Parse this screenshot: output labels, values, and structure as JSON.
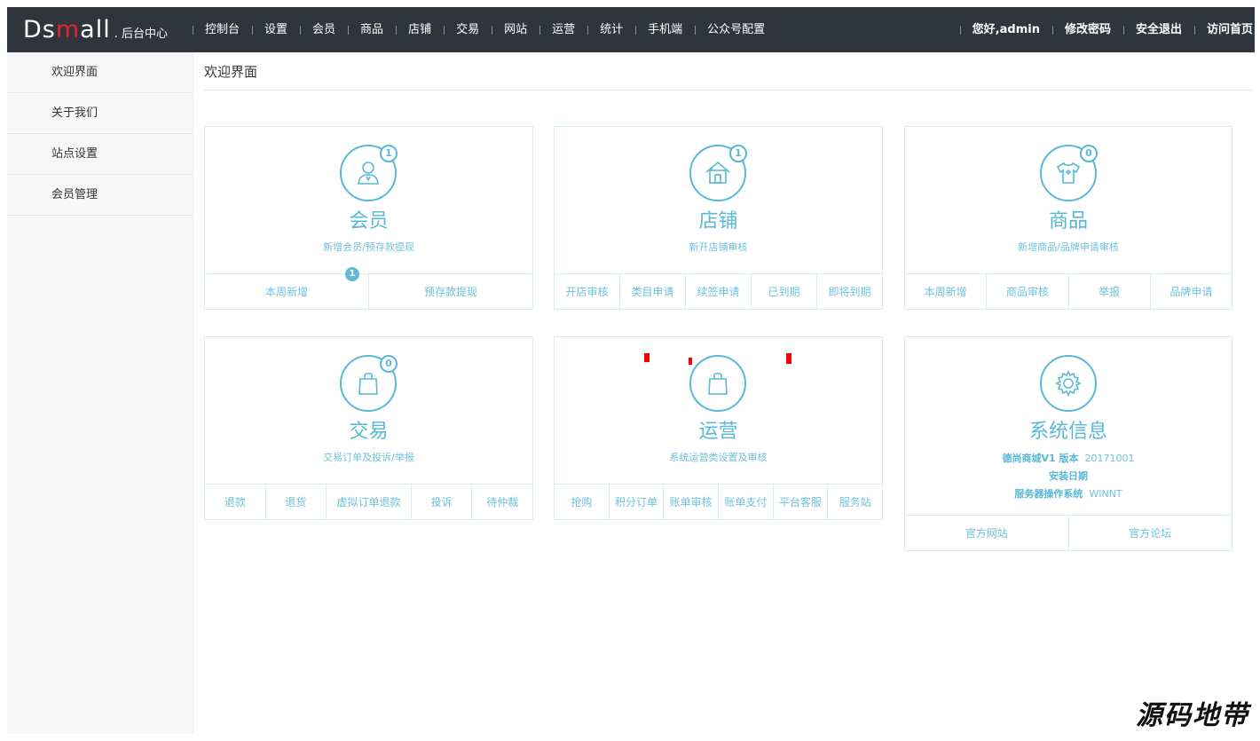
{
  "logo": {
    "main_a": "Ds",
    "main_m": "m",
    "main_b": "all",
    "sub": ". 后台中心"
  },
  "nav": [
    "控制台",
    "设置",
    "会员",
    "商品",
    "店铺",
    "交易",
    "网站",
    "运营",
    "统计",
    "手机端",
    "公众号配置"
  ],
  "user_nav": [
    "您好,admin",
    "修改密码",
    "安全退出",
    "访问首页"
  ],
  "sidebar": [
    "欢迎界面",
    "关于我们",
    "站点设置",
    "会员管理"
  ],
  "page_title": "欢迎界面",
  "cards": {
    "member": {
      "title": "会员",
      "sub": "新增会员/预存款提现",
      "badge": "1",
      "cells": [
        "本周新增",
        "预存款提现"
      ],
      "cell_badge": "1",
      "icon": "user-icon"
    },
    "store": {
      "title": "店铺",
      "sub": "新开店铺审核",
      "badge": "1",
      "cells": [
        "开店审核",
        "类目申请",
        "续签申请",
        "已到期",
        "即将到期"
      ],
      "icon": "house-icon"
    },
    "goods": {
      "title": "商品",
      "sub": "新增商品/品牌申请审核",
      "badge": "0",
      "cells": [
        "本周新增",
        "商品审核",
        "举报",
        "品牌申请"
      ],
      "icon": "tshirt-icon"
    },
    "trade": {
      "title": "交易",
      "sub": "交易订单及投诉/举报",
      "badge": "0",
      "cells": [
        "退款",
        "退货",
        "虚拟订单退款",
        "投诉",
        "待仲裁"
      ],
      "icon": "bag-icon"
    },
    "operation": {
      "title": "运营",
      "sub": "系统运营类设置及审核",
      "cells": [
        "抢购",
        "积分订单",
        "账单审核",
        "账单支付",
        "平台客服",
        "服务站"
      ],
      "icon": "bag-icon"
    },
    "system": {
      "title": "系统信息",
      "version_label": "德尚商城V1 版本",
      "version_value": "20171001",
      "install_label": "安装日期",
      "server_label": "服务器操作系统",
      "server_value": "WINNT",
      "cells": [
        "官方网站",
        "官方论坛"
      ],
      "icon": "gear-icon"
    }
  },
  "watermark": "源码地带",
  "colors": {
    "topbar": "#30343d",
    "accent": "#58b8d7",
    "logo_red": "#e0262b"
  }
}
